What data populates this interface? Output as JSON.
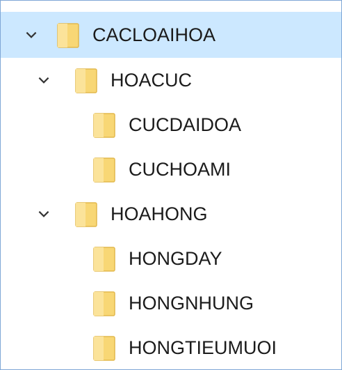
{
  "tree": {
    "root": {
      "label": "CACLOAIHOA",
      "expanded": true,
      "icon": "folder-icon",
      "children": [
        {
          "label": "HOACUC",
          "expanded": true,
          "icon": "folder-icon",
          "children": [
            {
              "label": "CUCDAIDOA",
              "icon": "folder-icon"
            },
            {
              "label": "CUCHOAMI",
              "icon": "folder-icon"
            }
          ]
        },
        {
          "label": "HOAHONG",
          "expanded": true,
          "icon": "folder-icon",
          "children": [
            {
              "label": "HONGDAY",
              "icon": "folder-icon"
            },
            {
              "label": "HONGNHUNG",
              "icon": "folder-icon"
            },
            {
              "label": "HONGTIEUMUOI",
              "icon": "folder-icon"
            }
          ]
        }
      ]
    }
  },
  "colors": {
    "selection": "#cce8ff",
    "border": "#7fa7d6",
    "folder_fill": "#f8d775",
    "folder_edge": "#e2b84d",
    "text": "#1b1b1b"
  }
}
